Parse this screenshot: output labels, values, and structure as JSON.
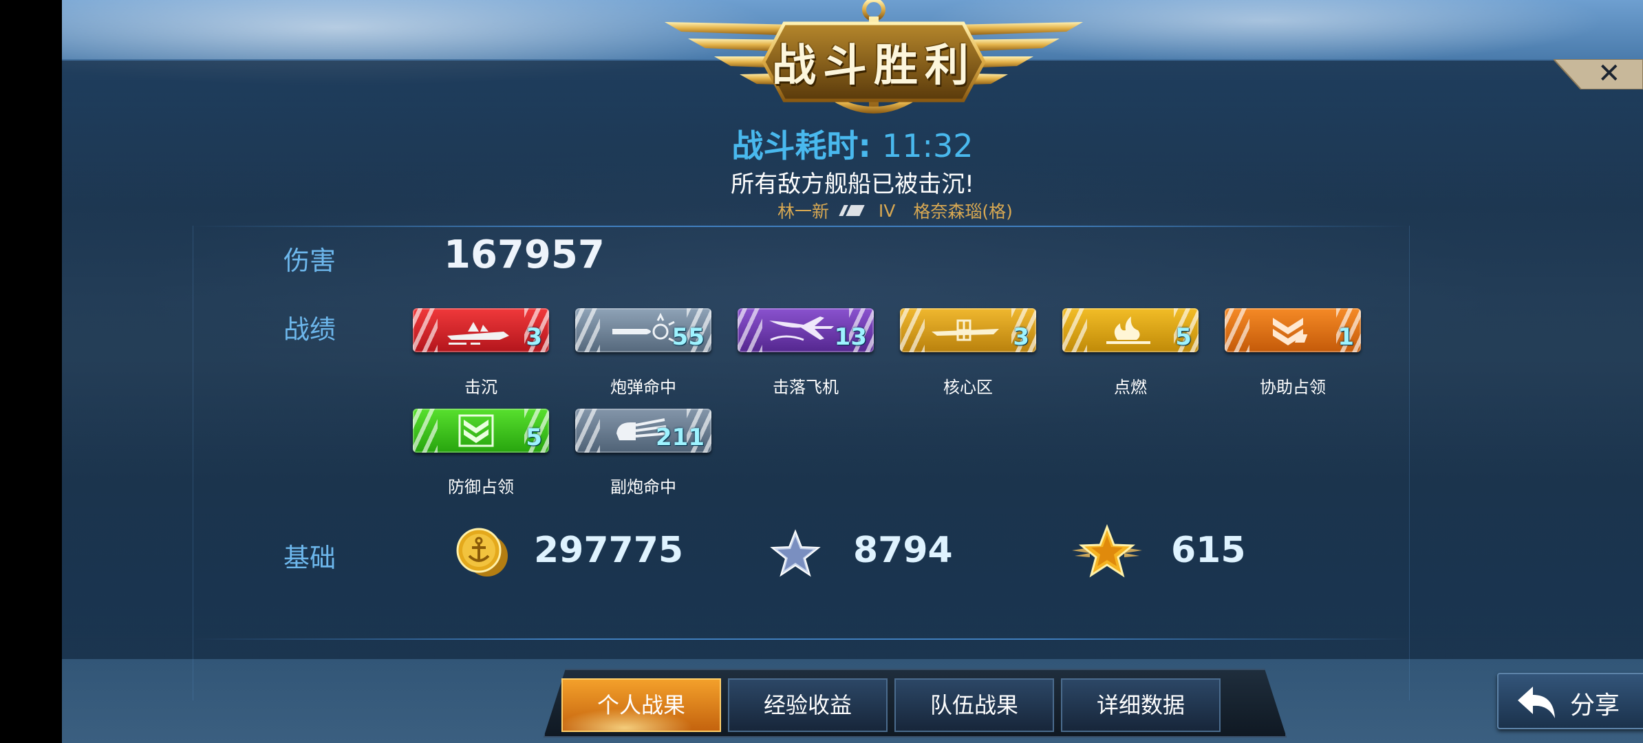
{
  "header": {
    "title": "战斗胜利",
    "battle_time_label": "战斗耗时:",
    "battle_time_value": "11:32",
    "result_text": "所有敌方舰船已被击沉!",
    "player_name": "林一新",
    "ship_tier": "IV",
    "ship_name": "格奈森瑙(格)"
  },
  "close_icon": "✕",
  "damage": {
    "label": "伤害",
    "value": "167957"
  },
  "achievements": {
    "label": "战绩",
    "medals": [
      {
        "name": "击沉",
        "count": "3",
        "icon": "ship-sinking-icon",
        "color": "#d9262a"
      },
      {
        "name": "炮弹命中",
        "count": "55",
        "icon": "shell-hit-icon",
        "color": "#7a8da0"
      },
      {
        "name": "击落飞机",
        "count": "13",
        "icon": "aircraft-shotdown-icon",
        "color": "#6d3aa8"
      },
      {
        "name": "核心区",
        "count": "3",
        "icon": "citadel-icon",
        "color": "#d9a01a"
      },
      {
        "name": "点燃",
        "count": "5",
        "icon": "fire-icon",
        "color": "#e0a510"
      },
      {
        "name": "协助占领",
        "count": "1",
        "icon": "assist-capture-icon",
        "color": "#e56f12"
      },
      {
        "name": "防御占领",
        "count": "5",
        "icon": "defend-capture-icon",
        "color": "#36c21a"
      },
      {
        "name": "副炮命中",
        "count": "211",
        "icon": "secondary-battery-icon",
        "color": "#6f8397"
      }
    ]
  },
  "base_rewards": {
    "label": "基础",
    "credits": "297775",
    "experience": "8794",
    "elite_experience": "615"
  },
  "tabs": [
    {
      "label": "个人战果",
      "active": true
    },
    {
      "label": "经验收益",
      "active": false
    },
    {
      "label": "队伍战果",
      "active": false
    },
    {
      "label": "详细数据",
      "active": false
    }
  ],
  "share_label": "分享"
}
